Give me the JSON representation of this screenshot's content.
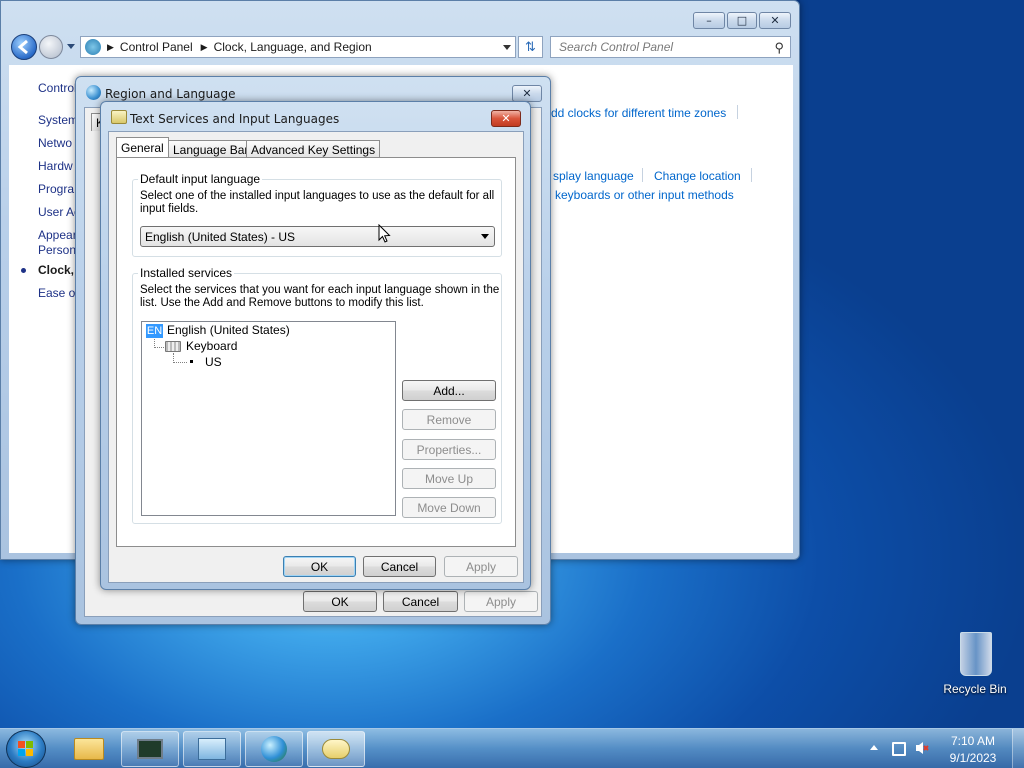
{
  "control_panel": {
    "breadcrumb": [
      "Control Panel",
      "Clock, Language, and Region"
    ],
    "search_placeholder": "Search Control Panel",
    "left_nav": [
      "Control",
      "System",
      "Netwo",
      "Hardw",
      "Progra",
      "User Ac",
      "Appear",
      "Person",
      "Clock, L",
      "Ease of"
    ],
    "links": {
      "add_clocks": "dd clocks for different time zones",
      "display_language": "splay language",
      "change_location": "Change location",
      "keyboards": "keyboards or other input methods"
    }
  },
  "region_dialog": {
    "title": "Region and Language",
    "tab_stub": "K",
    "buttons": {
      "ok": "OK",
      "cancel": "Cancel",
      "apply": "Apply"
    }
  },
  "text_services_dialog": {
    "title": "Text Services and Input Languages",
    "tabs": [
      "General",
      "Language Bar",
      "Advanced Key Settings"
    ],
    "default_input": {
      "legend": "Default input language",
      "description": "Select one of the installed input languages to use as the default for all input fields.",
      "selected": "English (United States) - US"
    },
    "installed_services": {
      "legend": "Installed services",
      "description": "Select the services that you want for each input language shown in the list. Use the Add and Remove buttons to modify this list.",
      "tree": {
        "badge": "EN",
        "language": "English (United States)",
        "category": "Keyboard",
        "layout": "US"
      },
      "buttons": {
        "add": "Add...",
        "remove": "Remove",
        "properties": "Properties...",
        "move_up": "Move Up",
        "move_down": "Move Down"
      }
    },
    "buttons": {
      "ok": "OK",
      "cancel": "Cancel",
      "apply": "Apply"
    }
  },
  "desktop": {
    "recycle_bin": "Recycle Bin"
  },
  "taskbar": {
    "time": "7:10 AM",
    "date": "9/1/2023"
  }
}
